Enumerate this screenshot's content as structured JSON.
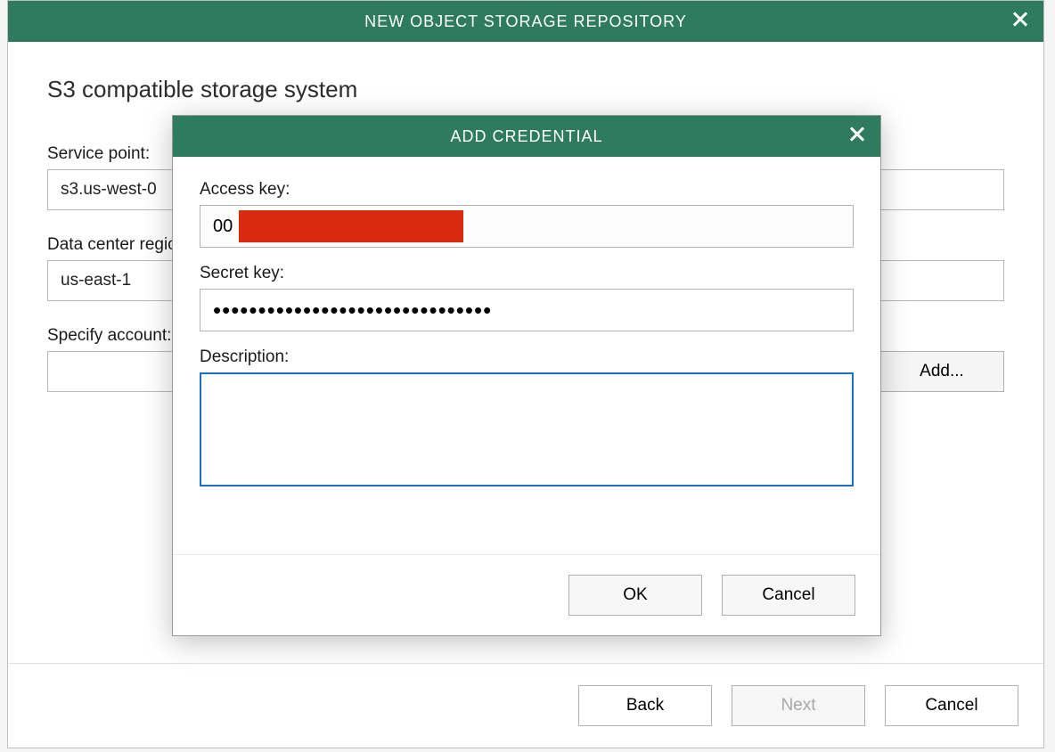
{
  "main": {
    "title": "NEW OBJECT STORAGE REPOSITORY",
    "heading": "S3 compatible storage system",
    "service_point_label": "Service point:",
    "service_point_value": "s3.us-west-0",
    "data_center_label": "Data center region:",
    "data_center_value": "us-east-1",
    "specify_account_label": "Specify account:",
    "add_button": "Add...",
    "footer": {
      "back": "Back",
      "next": "Next",
      "cancel": "Cancel"
    }
  },
  "modal": {
    "title": "ADD CREDENTIAL",
    "access_key_label": "Access key:",
    "access_key_value": "00                                       002",
    "secret_key_label": "Secret key:",
    "secret_key_value": "•••••••••••••••••••••••••••••••",
    "description_label": "Description:",
    "description_value": "",
    "ok": "OK",
    "cancel": "Cancel"
  }
}
